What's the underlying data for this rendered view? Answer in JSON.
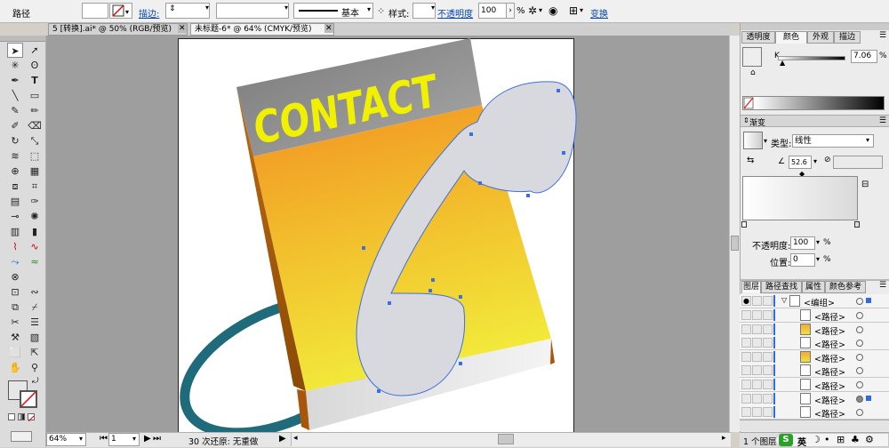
{
  "control_bar": {
    "object_type": "路径",
    "stroke_label": "描边:",
    "stroke_weight": "",
    "brush_name": "基本",
    "style_label": "样式:",
    "opacity_label": "不透明度",
    "opacity_value": "100",
    "opacity_unit": "%",
    "transform_link": "变换"
  },
  "doc_tabs": [
    {
      "label": "5 [转换].ai* @ 50% (RGB/预览)",
      "active": false
    },
    {
      "label": "未标题-6* @ 64% (CMYK/预览)",
      "active": true
    }
  ],
  "artwork": {
    "book_title": "CONTACT",
    "colors": {
      "book_top": "#f29222",
      "book_bottom": "#f2e93a",
      "title_text": "#f0f000",
      "header_bg": "#8a8a8a",
      "phone_fill": "#d8d9de",
      "ring": "#1f6b7c",
      "selection": "#3d6fe0"
    }
  },
  "status_bar": {
    "zoom": "64%",
    "page": "1",
    "undo_info": "30 次还原: 无重做"
  },
  "color_panel": {
    "tabs": [
      "透明度",
      "颜色",
      "外观",
      "描边"
    ],
    "active_tab": "颜色",
    "channel": "K",
    "value": "7.06",
    "unit": "%"
  },
  "gradient_panel": {
    "title": "渐变",
    "type_label": "类型:",
    "type_value": "线性",
    "angle_value": "52.6",
    "opacity_label": "不透明度:",
    "opacity_value": "100",
    "opacity_unit": "%",
    "position_label": "位置:",
    "position_value": "0",
    "position_unit": "%"
  },
  "layers_panel": {
    "tabs": [
      "图层",
      "路径查找",
      "属性",
      "颜色参考"
    ],
    "active_tab": "图层",
    "rows": [
      {
        "name": "<编组>",
        "thumb": "group"
      },
      {
        "name": "<路径>",
        "thumb": "white"
      },
      {
        "name": "<路径>",
        "thumb": "yellow"
      },
      {
        "name": "<路径>",
        "thumb": "white"
      },
      {
        "name": "<路径>",
        "thumb": "yellow"
      },
      {
        "name": "<路径>",
        "thumb": "white"
      },
      {
        "name": "<路径>",
        "thumb": "white"
      },
      {
        "name": "<路径>",
        "thumb": "white"
      },
      {
        "name": "<路径>",
        "thumb": "white"
      }
    ],
    "footer": "1 个图层"
  },
  "taskbar": {
    "ime_label": "英"
  }
}
